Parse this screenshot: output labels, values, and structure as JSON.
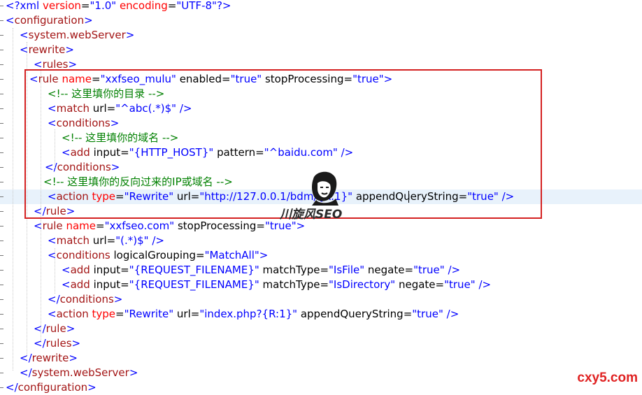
{
  "editor": {
    "lines": [
      {
        "tokens": [
          [
            "decl",
            "<?xml "
          ],
          [
            "attr",
            "version"
          ],
          [
            "text",
            "="
          ],
          [
            "value",
            "\"1.0\""
          ],
          [
            "text",
            " "
          ],
          [
            "attr",
            "encoding"
          ],
          [
            "text",
            "="
          ],
          [
            "value",
            "\"UTF-8\""
          ],
          [
            "decl",
            "?>"
          ]
        ]
      },
      {
        "tokens": [
          [
            "bracket",
            "<"
          ],
          [
            "tag",
            "configuration"
          ],
          [
            "bracket",
            ">"
          ]
        ]
      },
      {
        "tokens": [
          [
            "bracket",
            "<"
          ],
          [
            "tag",
            "system.webServer"
          ],
          [
            "bracket",
            ">"
          ]
        ]
      },
      {
        "tokens": [
          [
            "bracket",
            "<"
          ],
          [
            "tag",
            "rewrite"
          ],
          [
            "bracket",
            ">"
          ]
        ]
      },
      {
        "tokens": [
          [
            "bracket",
            "<"
          ],
          [
            "tag",
            "rules"
          ],
          [
            "bracket",
            ">"
          ]
        ]
      },
      {
        "tokens": [
          [
            "bracket",
            "<"
          ],
          [
            "tag",
            "rule"
          ],
          [
            "text",
            " "
          ],
          [
            "attr",
            "name"
          ],
          [
            "text",
            "="
          ],
          [
            "value",
            "\"xxfseo_mulu\""
          ],
          [
            "text",
            " enabled="
          ],
          [
            "value",
            "\"true\""
          ],
          [
            "text",
            " stopProcessing="
          ],
          [
            "value",
            "\"true\""
          ],
          [
            "bracket",
            ">"
          ]
        ]
      },
      {
        "tokens": [
          [
            "comment",
            "<!-- 这里填你的目录 -->"
          ]
        ]
      },
      {
        "tokens": [
          [
            "bracket",
            "<"
          ],
          [
            "tag",
            "match"
          ],
          [
            "text",
            " url="
          ],
          [
            "value",
            "\"^abc(.*)$\""
          ],
          [
            "text",
            " "
          ],
          [
            "bracket",
            "/>"
          ]
        ]
      },
      {
        "tokens": [
          [
            "bracket",
            "<"
          ],
          [
            "tag",
            "conditions"
          ],
          [
            "bracket",
            ">"
          ]
        ]
      },
      {
        "tokens": [
          [
            "comment",
            "<!-- 这里填你的域名 -->"
          ]
        ]
      },
      {
        "tokens": [
          [
            "bracket",
            "<"
          ],
          [
            "tag",
            "add"
          ],
          [
            "text",
            " input="
          ],
          [
            "value",
            "\"{HTTP_HOST}\""
          ],
          [
            "text",
            " pattern="
          ],
          [
            "value",
            "\"^baidu.com\""
          ],
          [
            "text",
            " "
          ],
          [
            "bracket",
            "/>"
          ]
        ]
      },
      {
        "tokens": [
          [
            "bracket",
            "</"
          ],
          [
            "tag",
            "conditions"
          ],
          [
            "bracket",
            ">"
          ]
        ]
      },
      {
        "tokens": [
          [
            "comment",
            "<!-- 这里填你的反向过来的IP或域名 -->"
          ]
        ]
      },
      {
        "tokens": [
          [
            "bracket",
            "<"
          ],
          [
            "tag",
            "action"
          ],
          [
            "text",
            " "
          ],
          [
            "attr",
            "type"
          ],
          [
            "text",
            "="
          ],
          [
            "value",
            "\"Rewrite\""
          ],
          [
            "text",
            " url="
          ],
          [
            "value",
            "\"http://127.0.0.1/bdm/"
          ],
          [
            "value",
            "{R:1}\""
          ],
          [
            "text",
            " appendQueryString="
          ],
          [
            "value",
            "\"true\""
          ],
          [
            "text",
            " "
          ],
          [
            "bracket",
            "/>"
          ]
        ]
      },
      {
        "tokens": [
          [
            "bracket",
            "</"
          ],
          [
            "tag",
            "rule"
          ],
          [
            "bracket",
            ">"
          ]
        ]
      },
      {
        "tokens": [
          [
            "bracket",
            "<"
          ],
          [
            "tag",
            "rule"
          ],
          [
            "text",
            " "
          ],
          [
            "attr",
            "name"
          ],
          [
            "text",
            "="
          ],
          [
            "value",
            "\"xxfseo.com\""
          ],
          [
            "text",
            " stopProcessing="
          ],
          [
            "value",
            "\"true\""
          ],
          [
            "bracket",
            ">"
          ]
        ]
      },
      {
        "tokens": [
          [
            "bracket",
            "<"
          ],
          [
            "tag",
            "match"
          ],
          [
            "text",
            " url="
          ],
          [
            "value",
            "\"(.*)$\""
          ],
          [
            "text",
            " "
          ],
          [
            "bracket",
            "/>"
          ]
        ]
      },
      {
        "tokens": [
          [
            "bracket",
            "<"
          ],
          [
            "tag",
            "conditions"
          ],
          [
            "text",
            " logicalGrouping="
          ],
          [
            "value",
            "\"MatchAll\""
          ],
          [
            "bracket",
            ">"
          ]
        ]
      },
      {
        "tokens": [
          [
            "bracket",
            "<"
          ],
          [
            "tag",
            "add"
          ],
          [
            "text",
            " input="
          ],
          [
            "value",
            "\"{REQUEST_FILENAME}\""
          ],
          [
            "text",
            " matchType="
          ],
          [
            "value",
            "\"IsFile\""
          ],
          [
            "text",
            " negate="
          ],
          [
            "value",
            "\"true\""
          ],
          [
            "text",
            " "
          ],
          [
            "bracket",
            "/>"
          ]
        ]
      },
      {
        "tokens": [
          [
            "bracket",
            "<"
          ],
          [
            "tag",
            "add"
          ],
          [
            "text",
            " input="
          ],
          [
            "value",
            "\"{REQUEST_FILENAME}\""
          ],
          [
            "text",
            " matchType="
          ],
          [
            "value",
            "\"IsDirectory\""
          ],
          [
            "text",
            " negate="
          ],
          [
            "value",
            "\"true\""
          ],
          [
            "text",
            " "
          ],
          [
            "bracket",
            "/>"
          ]
        ]
      },
      {
        "tokens": [
          [
            "bracket",
            "</"
          ],
          [
            "tag",
            "conditions"
          ],
          [
            "bracket",
            ">"
          ]
        ]
      },
      {
        "tokens": [
          [
            "bracket",
            "<"
          ],
          [
            "tag",
            "action"
          ],
          [
            "text",
            " "
          ],
          [
            "attr",
            "type"
          ],
          [
            "text",
            "="
          ],
          [
            "value",
            "\"Rewrite\""
          ],
          [
            "text",
            " url="
          ],
          [
            "value",
            "\"index.php?{R:1}\""
          ],
          [
            "text",
            " appendQueryString="
          ],
          [
            "value",
            "\"true\""
          ],
          [
            "text",
            " "
          ],
          [
            "bracket",
            "/>"
          ]
        ]
      },
      {
        "tokens": [
          [
            "bracket",
            "</"
          ],
          [
            "tag",
            "rule"
          ],
          [
            "bracket",
            ">"
          ]
        ]
      },
      {
        "tokens": [
          [
            "bracket",
            "</"
          ],
          [
            "tag",
            "rules"
          ],
          [
            "bracket",
            ">"
          ]
        ]
      },
      {
        "tokens": [
          [
            "bracket",
            "</"
          ],
          [
            "tag",
            "rewrite"
          ],
          [
            "bracket",
            ">"
          ]
        ]
      },
      {
        "tokens": [
          [
            "bracket",
            "</"
          ],
          [
            "tag",
            "system.webServer"
          ],
          [
            "bracket",
            ">"
          ]
        ]
      },
      {
        "tokens": [
          [
            "bracket",
            "</"
          ],
          [
            "tag",
            "configuration"
          ],
          [
            "bracket",
            ">"
          ]
        ]
      }
    ]
  },
  "watermark": {
    "logo_text": "川旋风SEO"
  },
  "site_mark": "cxy5.com",
  "colors": {
    "highlight_border": "#d42121",
    "tag": "#a31515",
    "attribute": "#ff0000",
    "value": "#0000ff",
    "comment": "#008000",
    "current_line": "#e8f2fb"
  }
}
